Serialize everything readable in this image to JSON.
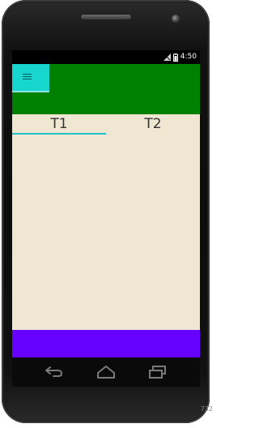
{
  "status_bar": {
    "time": "4:50"
  },
  "toolbar": {
    "menu_icon": "hamburger-menu-icon"
  },
  "tabs": [
    {
      "label": "T1",
      "selected": true
    },
    {
      "label": "T2",
      "selected": false
    }
  ],
  "colors": {
    "toolbar": "#008000",
    "menu_button": "#16d6cd",
    "content_bg": "#efe7d2",
    "tab_indicator": "#22c3c7",
    "bottom_bar": "#6600ff"
  },
  "nav_bar": {
    "back_icon": "back-icon",
    "home_icon": "home-icon",
    "recent_apps_icon": "recent-apps-icon"
  },
  "side_label": "732"
}
